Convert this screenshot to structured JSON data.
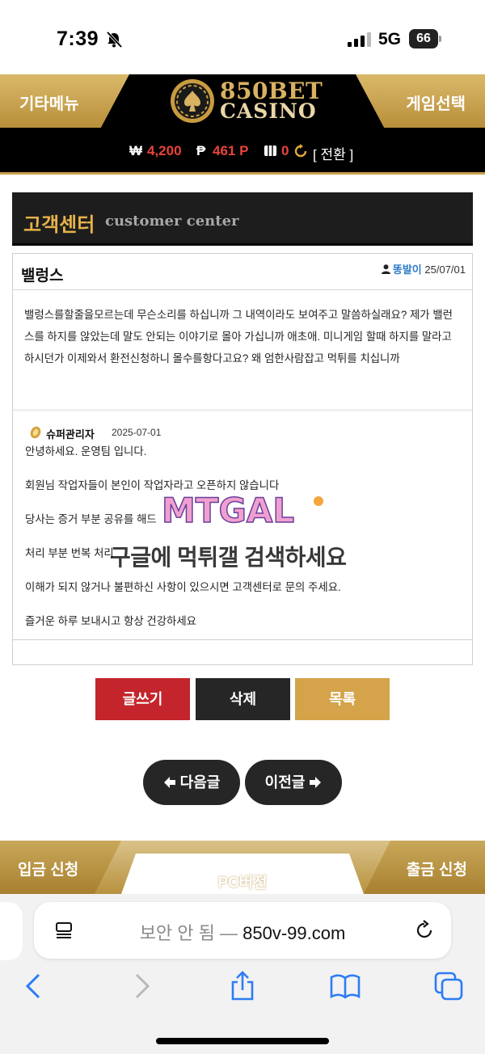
{
  "status": {
    "time": "7:39",
    "network": "5G",
    "battery": "66"
  },
  "header": {
    "left_menu": "기타메뉴",
    "right_menu": "게임선택",
    "logo_line1": "850BET",
    "logo_line2": "CASINO"
  },
  "balance": {
    "won_symbol": "₩",
    "won_value": "4,200",
    "point_symbol": "₱",
    "point_value": "461 P",
    "chip_value": "0",
    "convert_label": "[ 전환 ]"
  },
  "panel": {
    "title_ko": "고객센터",
    "title_en": "customer center"
  },
  "post": {
    "title": "밸렁스",
    "author": "똥발이",
    "date": "25/07/01",
    "body": "밸렁스를할줄을모르는데 무슨소리를 하십니까 그 내역이라도 보여주고 말씀하실래요? 제가 밸런스를 하지를 않았는데 말도 안되는 이야기로 몰아 가십니까 애초애. 미니게임 할때 하지를 말라고 하시던가 이제와서 환전신청하니 몰수를항다고요? 왜 엄한사람잡고 먹튀를 치십니까"
  },
  "reply": {
    "author": "슈퍼관리자",
    "date": "2025-07-01",
    "lines": [
      "안녕하세요. 운영팀 입니다.",
      "회원님 작업자들이 본인이 작업자라고 오픈하지 않습니다",
      "당사는 증거 부분 공유를 해드",
      "처리 부분 번복 처리",
      "이해가 되지 않거나 불편하신 사항이 있으시면 고객센터로 문의 주세요.",
      "즐거운 하루 보내시고 항상 건강하세요"
    ]
  },
  "watermark": {
    "logo": "MTGAL",
    "text": "구글에 먹튀갤 검색하세요"
  },
  "actions": {
    "write": "글쓰기",
    "delete": "삭제",
    "list": "목록"
  },
  "nav": {
    "next": "다음글",
    "prev": "이전글"
  },
  "footer": {
    "deposit": "입금 신청",
    "pc_version": "PC버전",
    "withdraw": "출금 신청"
  },
  "browser": {
    "insecure_label": "보안 안 됨 —",
    "domain": "850v-99.com"
  },
  "colors": {
    "gold": "#c9a24e",
    "red": "#c4242b",
    "dark": "#262626",
    "link_blue": "#2f7dc9"
  }
}
